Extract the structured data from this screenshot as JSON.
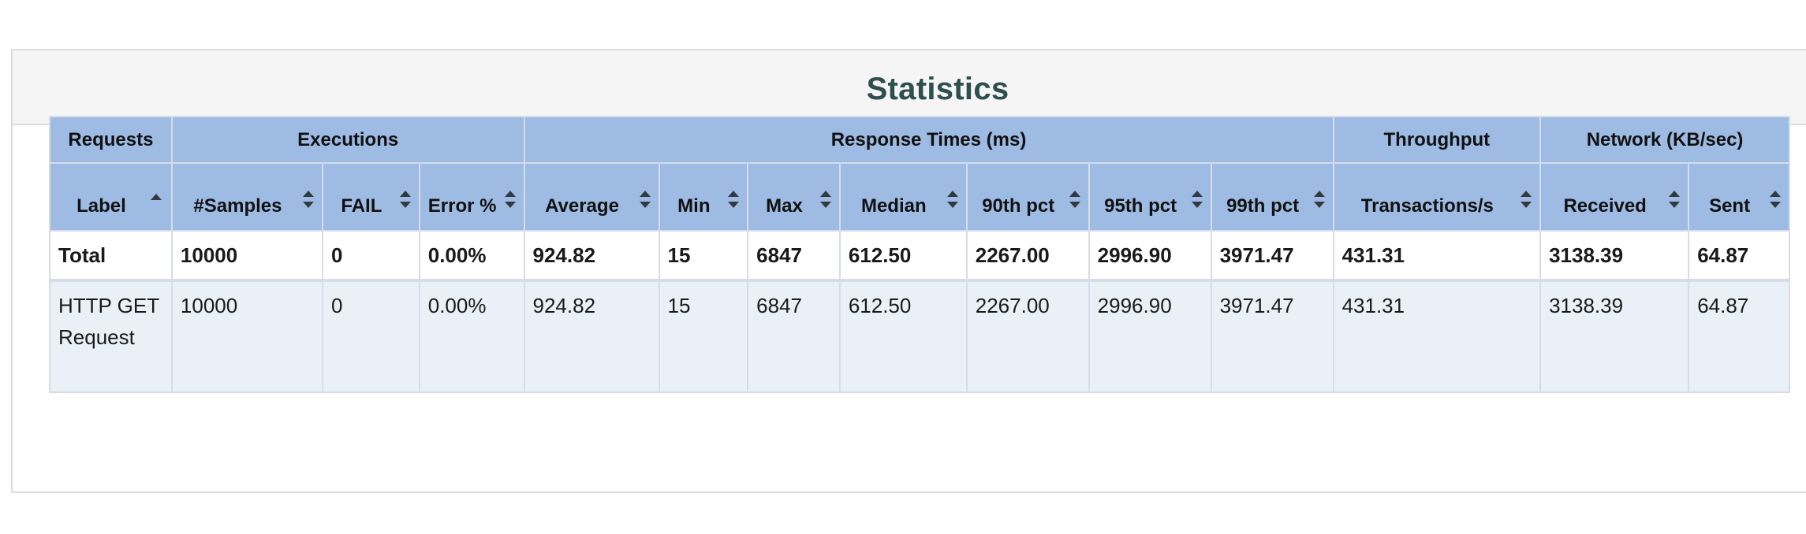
{
  "panel": {
    "title": "Statistics"
  },
  "table": {
    "groups": {
      "requests": "Requests",
      "executions": "Executions",
      "response_times": "Response Times (ms)",
      "throughput": "Throughput",
      "network": "Network (KB/sec)"
    },
    "columns": {
      "label": "Label",
      "samples": "#Samples",
      "fail": "FAIL",
      "error_pct": "Error %",
      "average": "Average",
      "min": "Min",
      "max": "Max",
      "median": "Median",
      "pct90": "90th pct",
      "pct95": "95th pct",
      "pct99": "99th pct",
      "transactions": "Transactions/s",
      "received": "Received",
      "sent": "Sent"
    },
    "sort": {
      "column": "Label",
      "direction": "ascending"
    },
    "rows": [
      {
        "label": "Total",
        "samples": "10000",
        "fail": "0",
        "error_pct": "0.00%",
        "average": "924.82",
        "min": "15",
        "max": "6847",
        "median": "612.50",
        "pct90": "2267.00",
        "pct95": "2996.90",
        "pct99": "3971.47",
        "transactions": "431.31",
        "received": "3138.39",
        "sent": "64.87"
      },
      {
        "label": "HTTP GET Request",
        "samples": "10000",
        "fail": "0",
        "error_pct": "0.00%",
        "average": "924.82",
        "min": "15",
        "max": "6847",
        "median": "612.50",
        "pct90": "2267.00",
        "pct95": "2996.90",
        "pct99": "3971.47",
        "transactions": "431.31",
        "received": "3138.39",
        "sent": "64.87"
      }
    ]
  },
  "colors": {
    "header_bg": "#9ebbe3",
    "title": "#2f4f4f",
    "row_alt_bg": "#eaf0f8",
    "border": "#d6dde8"
  },
  "icons": {
    "sort_both": "sort-icon",
    "sort_asc": "sort-ascending-icon"
  }
}
